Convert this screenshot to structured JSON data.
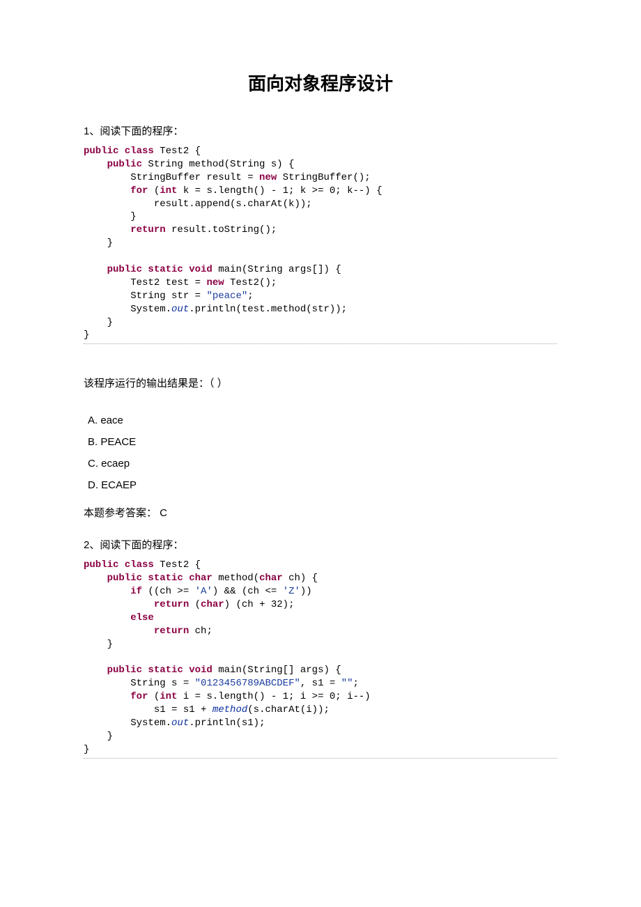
{
  "title": "面向对象程序设计",
  "q1": {
    "prompt": "1、阅读下面的程序：",
    "code": {
      "l1a": "public class",
      "l1b": " Test2 {",
      "l2a": "    public",
      "l2b": " String method(String s) {",
      "l3a": "        StringBuffer result = ",
      "l3b": "new",
      "l3c": " StringBuffer();",
      "l4a": "        for",
      "l4b": " (",
      "l4c": "int",
      "l4d": " k = s.length() - 1; k >= 0; k--) {",
      "l5": "            result.append(s.charAt(k));",
      "l6": "        }",
      "l7a": "        return",
      "l7b": " result.toString();",
      "l8": "    }",
      "l9": "",
      "l10a": "    public static void",
      "l10b": " main(String args[]) {",
      "l11a": "        Test2 test = ",
      "l11b": "new",
      "l11c": " Test2();",
      "l12a": "        String str = ",
      "l12b": "\"peace\"",
      "l12c": ";",
      "l13a": "        System.",
      "l13b": "out",
      "l13c": ".println(test.method(str));",
      "l14": "    }",
      "l15": "}"
    },
    "question": "该程序运行的输出结果是：（    ）",
    "opts": {
      "a": " A. eace",
      "b": " B. PEACE",
      "c": " C. ecaep",
      "d": " D. ECAEP"
    },
    "answer": "本题参考答案： C"
  },
  "q2": {
    "prompt": "2、阅读下面的程序：",
    "code": {
      "l1a": "public class",
      "l1b": " Test2 {",
      "l2a": "    public static char",
      "l2b": " method(",
      "l2c": "char",
      "l2d": " ch) {",
      "l3a": "        if",
      "l3b": " ((ch >= ",
      "l3c": "'A'",
      "l3d": ") && (ch <= ",
      "l3e": "'Z'",
      "l3f": "))",
      "l4a": "            return",
      "l4b": " (",
      "l4c": "char",
      "l4d": ") (ch + 32);",
      "l5a": "        else",
      "l6a": "            return",
      "l6b": " ch;",
      "l7": "    }",
      "l8": "",
      "l9a": "    public static void",
      "l9b": " main(String[] args) {",
      "l10a": "        String s = ",
      "l10b": "\"0123456789ABCDEF\"",
      "l10c": ", s1 = ",
      "l10d": "\"\"",
      "l10e": ";",
      "l11a": "        for",
      "l11b": " (",
      "l11c": "int",
      "l11d": " i = s.length() - 1; i >= 0; i--)",
      "l12a": "            s1 = s1 + ",
      "l12b": "method",
      "l12c": "(s.charAt(i));",
      "l13a": "        System.",
      "l13b": "out",
      "l13c": ".println(s1);",
      "l14": "    }",
      "l15": "}"
    }
  }
}
